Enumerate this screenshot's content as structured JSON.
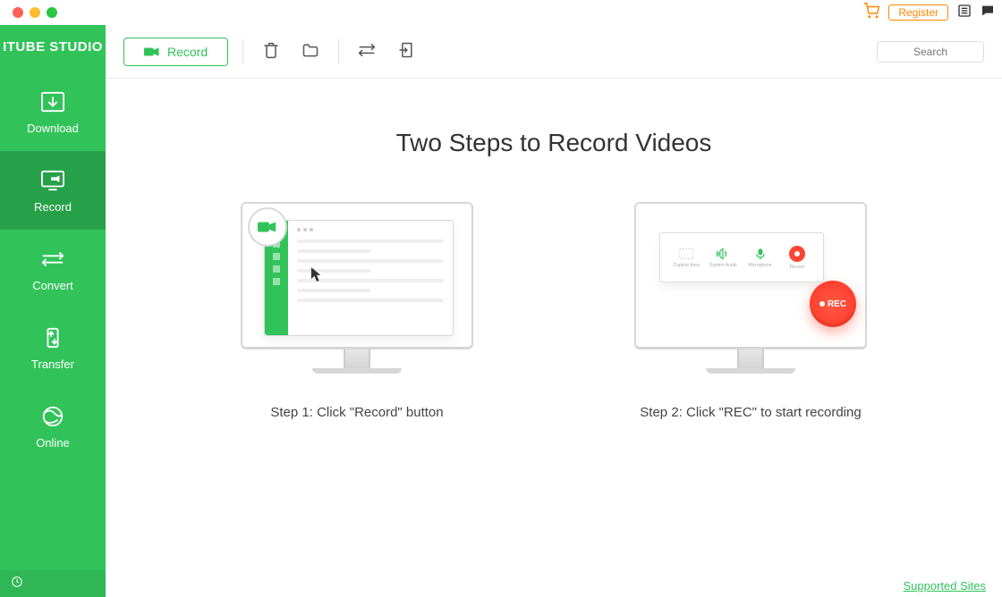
{
  "app_title": "ITUBE STUDIO",
  "topbar": {
    "register_label": "Register"
  },
  "sidebar": {
    "items": [
      {
        "label": "Download"
      },
      {
        "label": "Record"
      },
      {
        "label": "Convert"
      },
      {
        "label": "Transfer"
      },
      {
        "label": "Online"
      }
    ]
  },
  "toolbar": {
    "record_label": "Record",
    "search_placeholder": "Search"
  },
  "main": {
    "heading": "Two Steps to Record Videos",
    "step1_label": "Step 1: Click \"Record\" button",
    "step2_label": "Step 2: Click \"REC\" to start recording",
    "panel": {
      "opt1": "Capture Area",
      "opt2": "System Audio",
      "opt3": "Microphone",
      "opt4": "Record"
    },
    "rec_label": "REC"
  },
  "footer": {
    "supported_sites": "Supported Sites"
  }
}
